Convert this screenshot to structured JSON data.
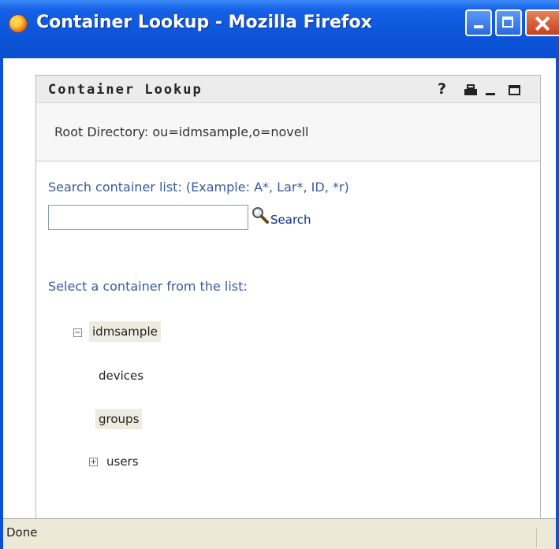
{
  "window": {
    "title": "Container Lookup - Mozilla Firefox"
  },
  "portlet": {
    "title": "Container Lookup",
    "help_label": "?",
    "root_directory": "Root Directory: ou=idmsample,o=novell"
  },
  "search": {
    "label": "Search container list: (Example: A*, Lar*, ID, *r)",
    "value": "",
    "placeholder": "",
    "button_label": "Search"
  },
  "tree": {
    "label": "Select a container from the list:",
    "root": {
      "label": "idmsample",
      "toggle": "−",
      "expanded": true,
      "highlighted": true
    },
    "children": [
      {
        "label": "devices",
        "highlighted": false,
        "expandable": false
      },
      {
        "label": "groups",
        "highlighted": true,
        "expandable": false
      },
      {
        "label": "users",
        "highlighted": false,
        "expandable": true,
        "toggle": "+"
      }
    ]
  },
  "status": {
    "text": "Done"
  },
  "colors": {
    "titlebar": "#0c55d8",
    "link": "#3a5a9e",
    "highlight": "#ececdf"
  }
}
